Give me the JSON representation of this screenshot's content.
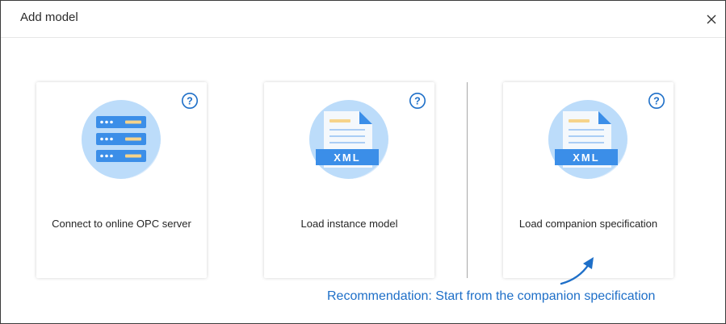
{
  "dialog": {
    "title": "Add model",
    "close_label": "×"
  },
  "cards": [
    {
      "label": "Connect to online OPC server",
      "icon": "server-icon"
    },
    {
      "label": "Load instance model",
      "icon": "xml-file-icon",
      "badge": "XML"
    },
    {
      "label": "Load companion specification",
      "icon": "xml-file-icon",
      "badge": "XML"
    }
  ],
  "help_label": "?",
  "recommendation": "Recommendation: Start from the companion specification",
  "colors": {
    "accent": "#1e6fc8",
    "icon_circle": "#bcdcfa",
    "icon_blue": "#3b8ee8",
    "icon_yellow": "#f6d38a"
  }
}
